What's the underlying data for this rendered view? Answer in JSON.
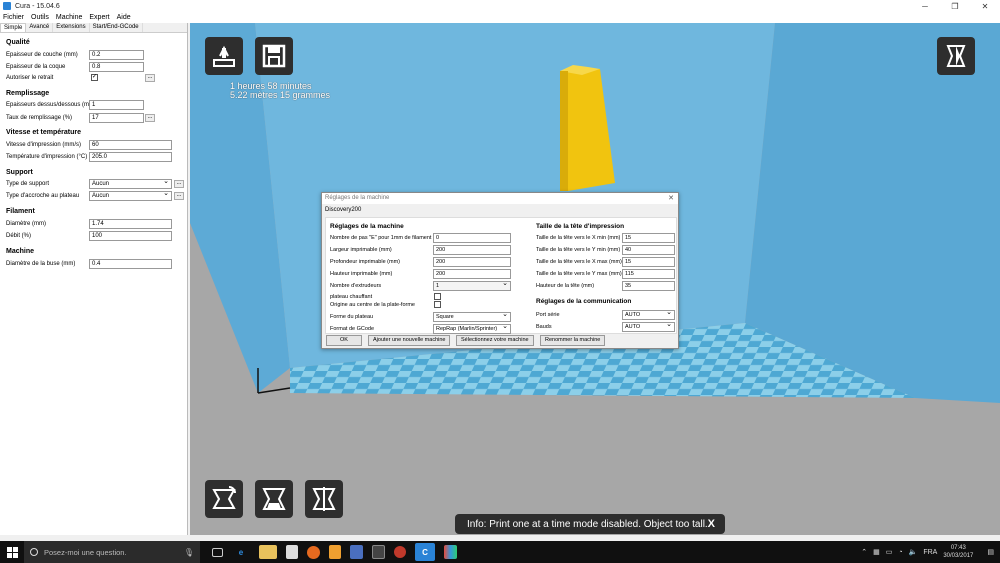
{
  "window": {
    "title": "Cura - 15.04.6",
    "minimize": "─",
    "maximize": "❐",
    "close": "✕"
  },
  "menu": [
    "Fichier",
    "Outils",
    "Machine",
    "Expert",
    "Aide"
  ],
  "tabs": [
    "Simple",
    "Avancé",
    "Extensions",
    "Start/End-GCode"
  ],
  "settings": {
    "quality": {
      "title": "Qualité",
      "layer_height_label": "Epaisseur de couche (mm)",
      "layer_height": "0.2",
      "shell_label": "Epaisseur de la coque",
      "shell": "0.8",
      "retract_label": "Autoriser le retrait",
      "retract_check": "✓",
      "dots": "..."
    },
    "fill": {
      "title": "Remplissage",
      "top_bottom_label": "Epaisseurs dessus/dessous (mm)",
      "top_bottom": "1",
      "density_label": "Taux de remplissage (%)",
      "density": "17"
    },
    "speed": {
      "title": "Vitesse et température",
      "print_speed_label": "Vitesse d'impression (mm/s)",
      "print_speed": "60",
      "temp_label": "Température d'impression (°C)",
      "temp": "205.0"
    },
    "support": {
      "title": "Support",
      "type_label": "Type de support",
      "type": "Aucun",
      "adhesion_label": "Type d'accroche au plateau",
      "adhesion": "Aucun"
    },
    "filament": {
      "title": "Filament",
      "diameter_label": "Diamètre (mm)",
      "diameter": "1.74",
      "flow_label": "Débit (%)",
      "flow": "100"
    },
    "machine": {
      "title": "Machine",
      "nozzle_label": "Diamètre de la buse (mm)",
      "nozzle": "0.4"
    }
  },
  "viewport": {
    "print_time": "1 heures 58 minutes",
    "print_material": "5.22 mètres 15 grammes",
    "info_message": "Info: Print one at a time mode disabled. Object too tall.",
    "info_close": "X"
  },
  "dialog": {
    "title": "Réglages de la machine",
    "close": "✕",
    "machine_tab": "Discovery200",
    "left_section": "Réglages de la machine",
    "steps_label": "Nombre de pas \"E\" pour  1mm de filament",
    "steps": "0",
    "width_label": "Largeur imprimable (mm)",
    "width": "200",
    "depth_label": "Profondeur imprimable (mm)",
    "depth": "200",
    "height_label": "Hauteur imprimable (mm)",
    "height": "200",
    "extruders_label": "Nombre d'extrudeurs",
    "extruders": "1",
    "heated_bed_label": "plateau chauffant",
    "origin_label": "Origine au centre de la plate-forme",
    "bed_shape_label": "Forme du plateau",
    "bed_shape": "Square",
    "gcode_label": "Format de GCode",
    "gcode": "RepRap (Marlin/Sprinter)",
    "right_section": "Taille de la tête d'impression",
    "x_min_label": "Taille de la tête vers le X min (mm)",
    "x_min": "15",
    "y_min_label": "Taille de la tête vers le Y min (mm)",
    "y_min": "40",
    "x_max_label": "Taille de la tête vers le X max (mm)",
    "x_max": "15",
    "y_max_label": "Taille de la tête vers le Y max (mm)",
    "y_max": "115",
    "head_height_label": "Hauteur de la tête (mm)",
    "head_height": "35",
    "comm_section": "Réglages de la communication",
    "port_label": "Port série",
    "port": "AUTO",
    "baud_label": "Bauds",
    "baud": "AUTO",
    "btn_ok": "OK",
    "btn_add": "Ajouter une nouvelle machine",
    "btn_select": "Sélectionnez votre machine",
    "btn_rename": "Renommer la machine"
  },
  "taskbar": {
    "search_placeholder": "Posez-moi une question.",
    "language": "FRA",
    "time": "07:43",
    "date": "30/03/2017"
  },
  "colors": {
    "wall": "#6fb7de",
    "floor_light": "#8ccfe9",
    "floor_dark": "#4ea8d3",
    "object": "#f1c40f",
    "button": "#2e2e2e"
  }
}
